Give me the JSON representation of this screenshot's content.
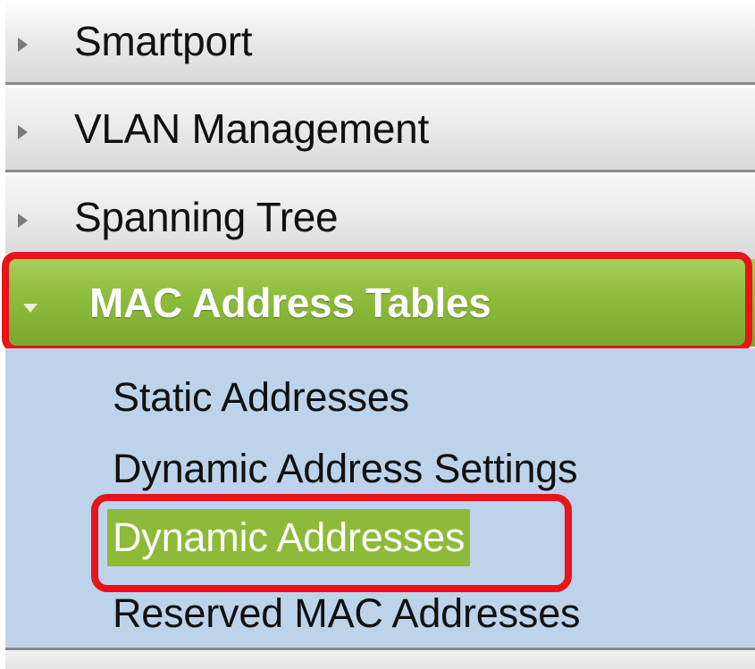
{
  "menu": {
    "items": [
      {
        "label": "Smartport",
        "expanded": false
      },
      {
        "label": "VLAN Management",
        "expanded": false
      },
      {
        "label": "Spanning Tree",
        "expanded": false
      }
    ],
    "active": {
      "label": "MAC Address Tables",
      "expanded": true,
      "children": [
        {
          "label": "Static Addresses",
          "selected": false
        },
        {
          "label": "Dynamic Address Settings",
          "selected": false
        },
        {
          "label": "Dynamic Addresses",
          "selected": true
        },
        {
          "label": "Reserved MAC Addresses",
          "selected": false
        }
      ]
    }
  },
  "colors": {
    "active_green": "#8fbd3d",
    "submenu_bg": "#bdd3ea",
    "highlight_red": "#e8131b"
  },
  "icons": {
    "collapsed": "triangle-right-icon",
    "expanded": "triangle-down-icon"
  }
}
